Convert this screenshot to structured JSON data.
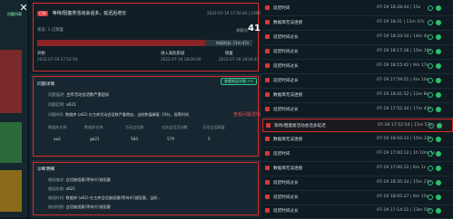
{
  "sidebar": {
    "nav_label": "问题列表"
  },
  "detail": {
    "badge": "已处",
    "title": "等待/阻塞类活动会话多，延迟后增长",
    "datetime": "2022-07-19 17:50:42 | 1092",
    "status_label": "状态: 1 已恢复",
    "score_label": "关联分",
    "score": "41",
    "elapsed": "持续时长: 11m 47s",
    "start_label": "开始",
    "start_time": "2022-07-19 17:52:54",
    "mid_label": "进入高危阶段",
    "mid_time": "2022-07-19 18:00:00",
    "end_label": "恢复",
    "end_time": "2022-07-19 18:04:41"
  },
  "problem": {
    "section_title": "问题详情",
    "button": "查看根因详情 >>",
    "desc_label": "问题描述:",
    "desc_value": "主库活动会话数严重超标",
    "instance_label": "问题实例:",
    "instance_value": "a621",
    "time_label": "问题时间:",
    "time_value": "数据库 (a62) 在主库活动会话数严重增加，当前数值峰值: 19分，报警时间",
    "table_headers": [
      "数据库名称",
      "数据库名称",
      "活动会话数",
      "业务会话活动数",
      "活动会话阈值"
    ],
    "table_row": [
      "aa2",
      "gb21",
      "584",
      "579",
      "5"
    ]
  },
  "diagnosis": {
    "section_title": "诊断明细",
    "rows": [
      {
        "label": "根因描述:",
        "value": "会话被阻塞(等待)行锁阻塞"
      },
      {
        "label": "根因实例:",
        "value": "a621"
      },
      {
        "label": "根因时间:",
        "value": "数据库 (a62) 在主库会话被阻塞(等待)行锁阻塞，当前..."
      },
      {
        "label": "根因明细:",
        "value": "会话被阻塞(等待)行锁阻塞"
      }
    ]
  },
  "annotation": "查看问题详情",
  "events": [
    {
      "badge": "已处",
      "title": "延迟时间",
      "time": "07-19 18:28:44 | 15s"
    },
    {
      "badge": "已处",
      "title": "数据库无法连接",
      "time": "07-19 18:31 | 11m 47s"
    },
    {
      "badge": "已处",
      "title": "延迟时间过长",
      "time": "07-19 18:33:34 | 14m 4s"
    },
    {
      "badge": "已处",
      "title": "延迟时间过长",
      "time": "07-19 18:17:28 | 15m 16s"
    },
    {
      "badge": "已处",
      "title": "延迟时间过长",
      "time": "07-19 18:15:42 | 9m 17s"
    },
    {
      "badge": "已处",
      "title": "延迟时间过长",
      "time": "07-19 17:59:51 | 4m 10s"
    },
    {
      "badge": "已处",
      "title": "数据库无法连接",
      "time": "07-19 18:41:52 | 12m 8s"
    },
    {
      "badge": "已处",
      "title": "延迟时间过长",
      "time": "07-19 17:52:34 | 17m 41s"
    },
    {
      "badge": "已处",
      "title": "等待/阻塞类活动会话多延迟",
      "time": "07-19 17:52:54 | 11m 57s"
    },
    {
      "badge": "已处",
      "title": "数据库无法连接",
      "time": "07-19 18:04:33 | 15m 37s"
    },
    {
      "badge": "已处",
      "title": "延迟时间",
      "time": "07-19 17:00:12 | 1h 10m 1s"
    },
    {
      "badge": "已处",
      "title": "数据库无法连接",
      "time": "07-19 17:00:12 | 6m 1s"
    },
    {
      "badge": "已处",
      "title": "延迟时间过长",
      "time": "07-19 18:35:34 | 15m 21s"
    },
    {
      "badge": "已处",
      "title": "延迟时间过长",
      "time": "07-19 18:05:27 | 9m 15s"
    },
    {
      "badge": "已处",
      "title": "延迟时间过长",
      "time": "07-19 17:14:31 | 13m 50s"
    }
  ],
  "colors": {
    "accent_red": "#d92b2b",
    "ok_green": "#2fbf6f",
    "panel": "#121e25"
  }
}
